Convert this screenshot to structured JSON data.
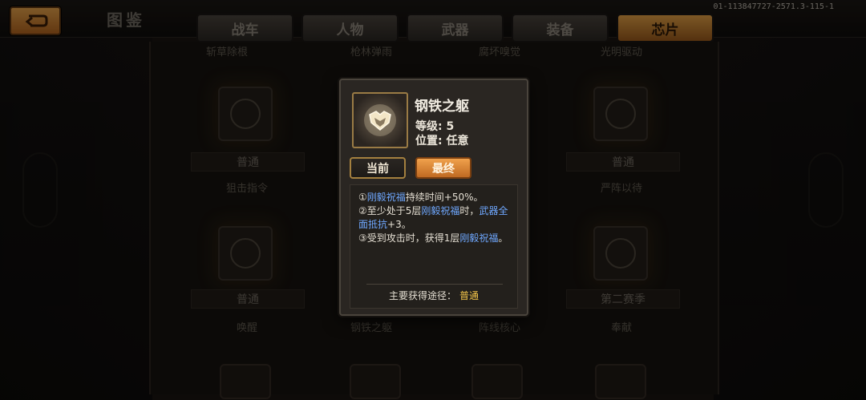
{
  "header": {
    "title": "图鉴",
    "version": "01-113847727-2571.3-115-1",
    "back_icon": "return-arrow-icon"
  },
  "tabs": [
    {
      "label": "战车",
      "active": false
    },
    {
      "label": "人物",
      "active": false
    },
    {
      "label": "武器",
      "active": false
    },
    {
      "label": "装备",
      "active": false
    },
    {
      "label": "芯片",
      "active": true
    }
  ],
  "grid": {
    "row1_names": [
      "斩草除根",
      "枪林弹雨",
      "腐坏嗅觉",
      "光明驱动"
    ],
    "row1_labels": [
      "普通",
      "普通"
    ],
    "row2_names": [
      "狙击指令",
      "严阵以待"
    ],
    "row2_labels": [
      "普通",
      "第二赛季"
    ],
    "row3_names": [
      "唤醒",
      "钢铁之躯",
      "阵线核心",
      "奉献"
    ]
  },
  "popup": {
    "name": "钢铁之躯",
    "level": "等级: 5",
    "position": "位置: 任意",
    "current_label": "当前",
    "final_label": "最终",
    "desc": {
      "l1_a": "①",
      "l1_hl": "刚毅祝福",
      "l1_b": "持续时间+50%。",
      "l2_a": "②至少处于5层",
      "l2_hl": "刚毅祝福",
      "l2_b": "时，",
      "l2_hl2": "武器全面抵抗",
      "l2_c": "+3。",
      "l3_a": "③受到攻击时，获得1层",
      "l3_hl": "刚毅祝福",
      "l3_b": "。"
    },
    "source_label": "主要获得途径：",
    "source_value": "普通"
  }
}
